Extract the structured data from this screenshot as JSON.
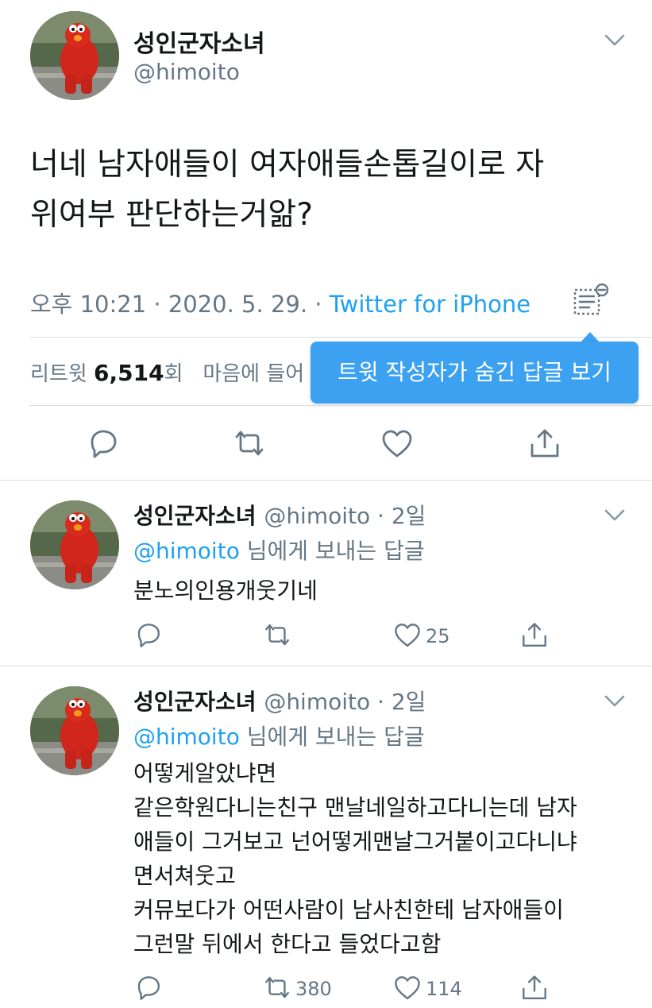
{
  "main_tweet": {
    "author_name": "성인군자소녀",
    "author_handle": "@himoito",
    "text_lines": [
      "너네 남자애들이 여자애들손톱길이로 자",
      "위여부 판단하는거앎?"
    ],
    "time": "오후 10:21",
    "date": "2020. 5. 29.",
    "separator": " · ",
    "source": "Twitter for iPhone",
    "retweets_label": "리트윗",
    "retweets_count": "6,514",
    "retweets_unit": "회",
    "likes_label_partial": "마음에 들어",
    "tooltip": "트윗 작성자가 숨긴 답글 보기"
  },
  "replies": [
    {
      "author_name": "성인군자소녀",
      "author_handle": "@himoito",
      "time": "2일",
      "reply_to_mention": "@himoito",
      "reply_to_suffix": " 님에게 보내는 답글",
      "text_lines": [
        "분노의인용개웃기네"
      ],
      "retweet_count": "",
      "like_count": "25"
    },
    {
      "author_name": "성인군자소녀",
      "author_handle": "@himoito",
      "time": "2일",
      "reply_to_mention": "@himoito",
      "reply_to_suffix": " 님에게 보내는 답글",
      "text_lines": [
        "어떻게알았냐면",
        "같은학원다니는친구 맨날네일하고다니는데 남자",
        "애들이 그거보고 넌어떻게맨날그거붙이고다니냐",
        "면서쳐웃고",
        "커뮤보다가 어떤사람이 남사친한테 남자애들이",
        "그런말 뒤에서 한다고 들었다고함"
      ],
      "retweet_count": "380",
      "like_count": "114"
    }
  ],
  "icons": {
    "reply": "reply-icon",
    "retweet": "retweet-icon",
    "like": "heart-icon",
    "share": "share-icon",
    "chevron": "chevron-down-icon",
    "hidden_replies": "hidden-replies-icon"
  },
  "colors": {
    "accent": "#1da1f2",
    "tooltip_bg": "#3ba1f0",
    "secondary_text": "#657786",
    "divider": "#d8dde2"
  }
}
